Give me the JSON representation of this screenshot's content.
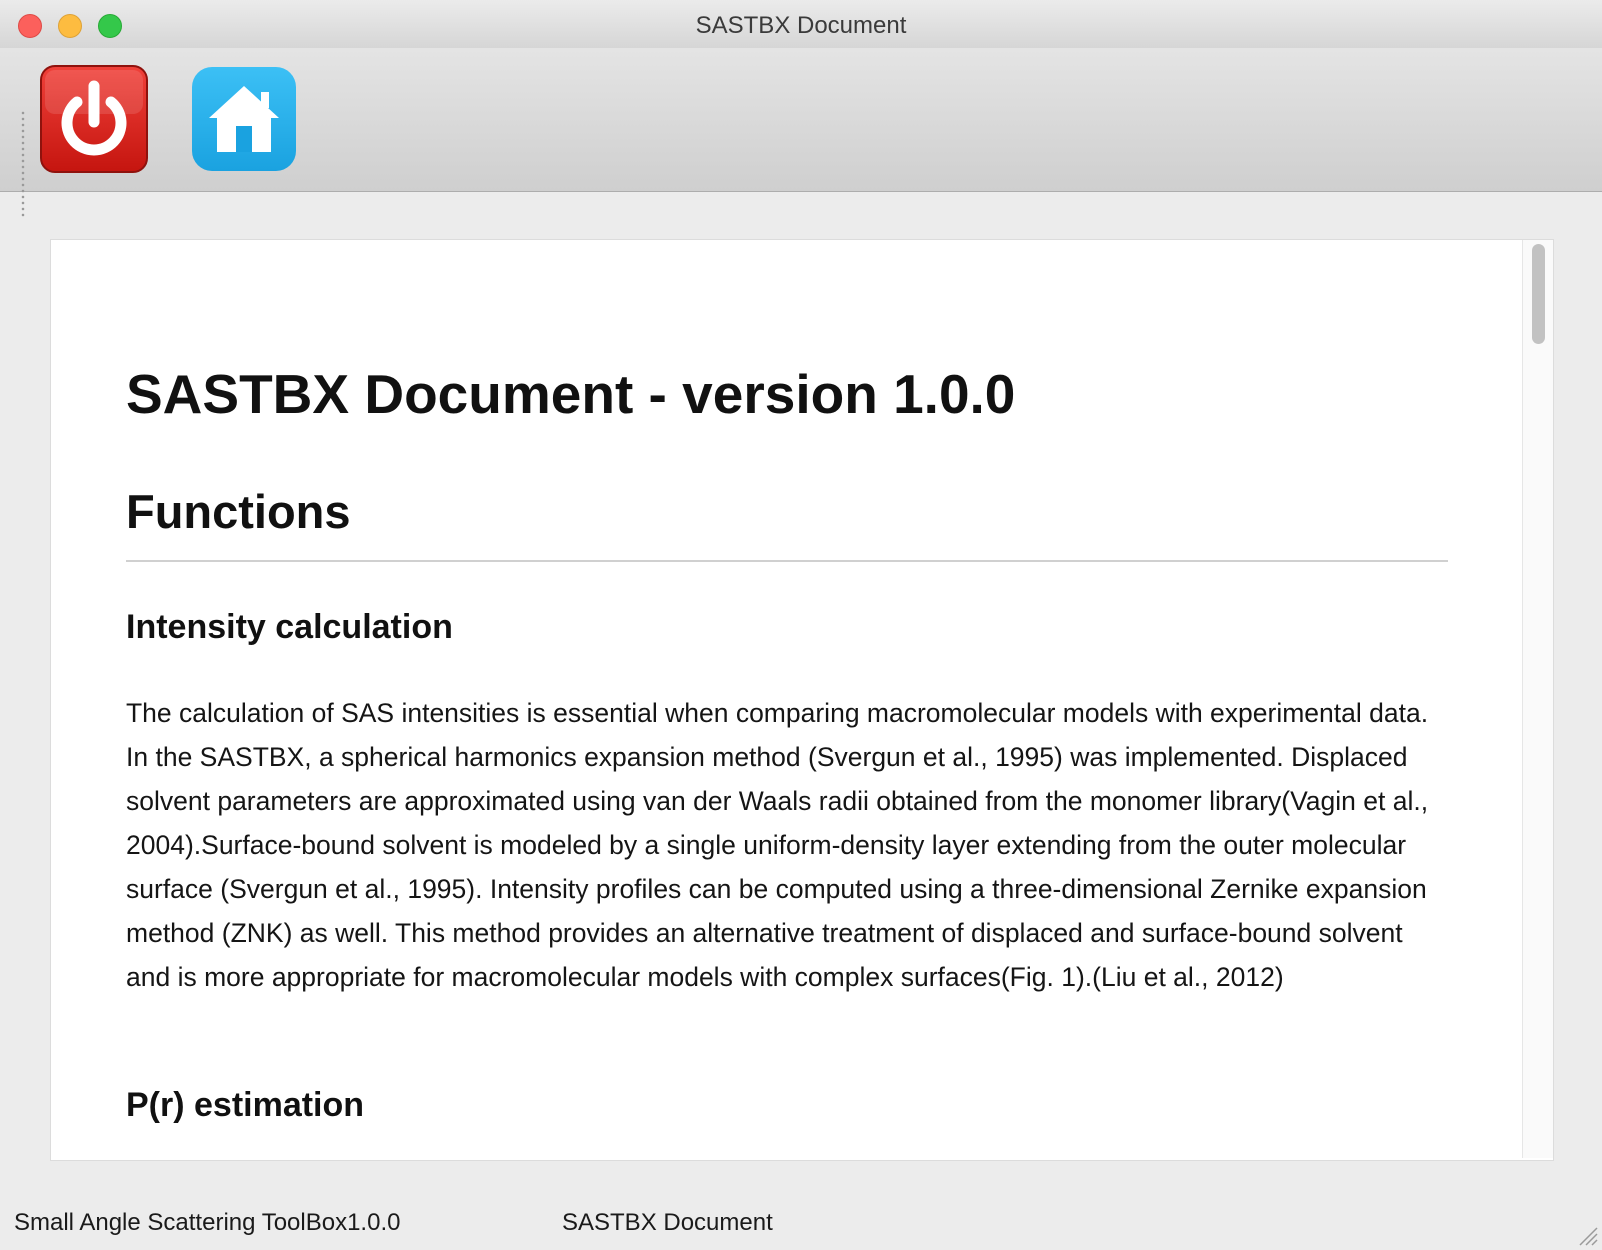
{
  "window": {
    "title": "SASTBX Document"
  },
  "toolbar": {
    "buttons": [
      {
        "icon": "power-icon",
        "color": "#d8221c"
      },
      {
        "icon": "home-icon",
        "color": "#1f9be0"
      }
    ]
  },
  "document": {
    "title": "SASTBX Document - version 1.0.0",
    "section_heading": "Functions",
    "subsections": [
      {
        "heading": "Intensity calculation",
        "body": "The calculation of SAS intensities is essential when comparing macromolecular models with experimental data. In the SASTBX, a spherical harmonics expansion method (Svergun et al., 1995) was implemented. Displaced solvent parameters are approximated using van der Waals radii obtained from the monomer library(Vagin et al., 2004).Surface-bound solvent is modeled by a single uniform-density layer extending from the outer molecular surface (Svergun et al., 1995). Intensity profiles can be computed using a three-dimensional Zernike expansion method (ZNK) as well. This method provides an alternative treatment of displaced and surface-bound solvent and is more appropriate for macromolecular models with complex surfaces(Fig. 1).(Liu et al., 2012)"
      },
      {
        "heading": "P(r) estimation"
      }
    ]
  },
  "statusbar": {
    "left": "Small Angle Scattering ToolBox1.0.0",
    "right": "SASTBX Document"
  }
}
